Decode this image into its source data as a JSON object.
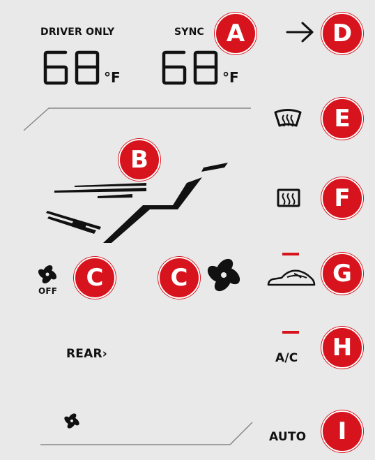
{
  "labels": {
    "driver_only": "DRIVER ONLY",
    "sync": "SYNC",
    "left_temp": "68",
    "right_temp": "68",
    "temp_unit": "°F",
    "fan_off": "OFF",
    "rear": "REAR",
    "ac": "A/C",
    "auto": "AUTO"
  },
  "badges": {
    "a": "A",
    "b": "B",
    "c1": "C",
    "c2": "C",
    "d": "D",
    "e": "E",
    "f": "F",
    "g": "G",
    "h": "H",
    "i": "I"
  },
  "colors": {
    "badge": "#d7141d",
    "indicator": "#d7141d",
    "background": "#e9e9e9",
    "ink": "#111111"
  },
  "icons": [
    "arrow-right-icon",
    "windshield-defrost-icon",
    "rear-defrost-icon",
    "recirculation-car-icon",
    "fan-icon",
    "chevron-right-icon",
    "airflow-seat-icon"
  ]
}
